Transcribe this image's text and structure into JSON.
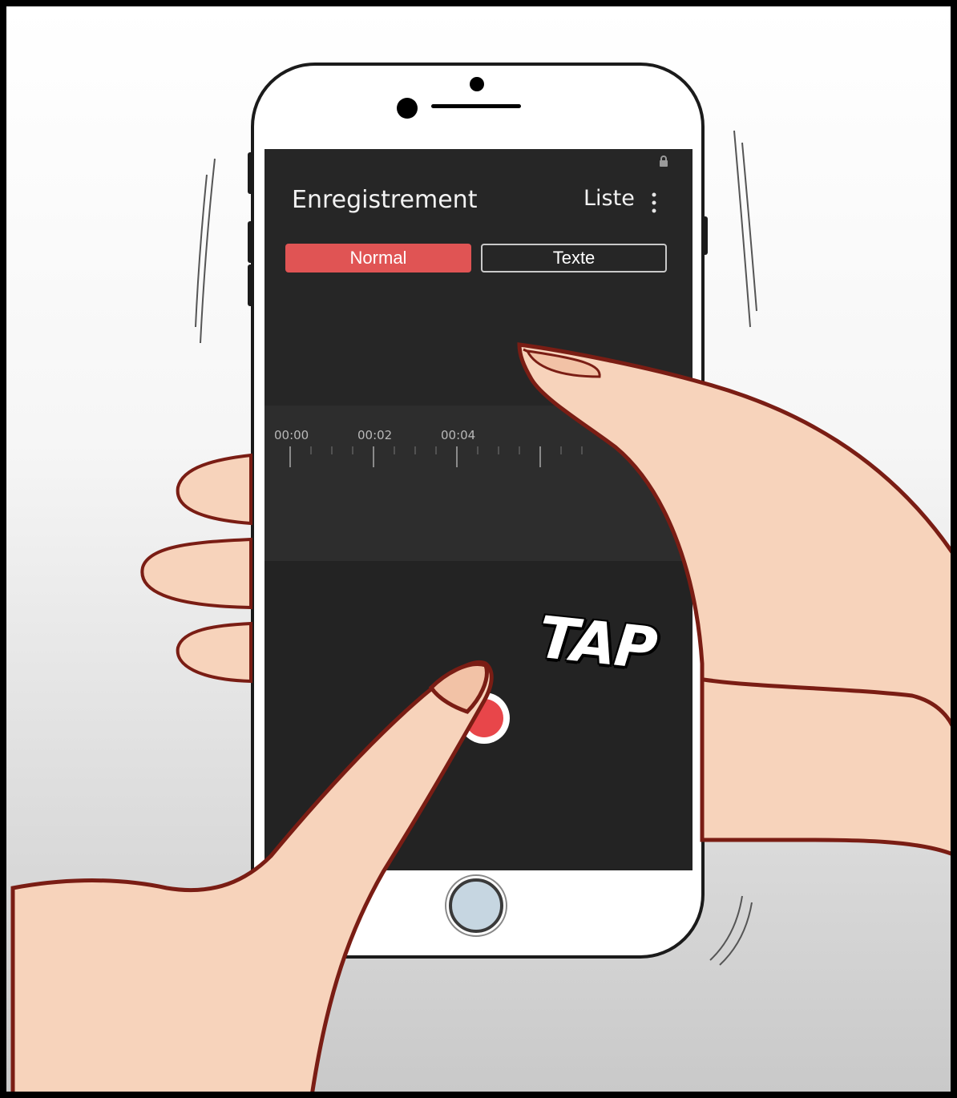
{
  "app": {
    "title": "Enregistrement",
    "list_label": "Liste",
    "menu_icon": "more-vertical-icon",
    "lock_icon": "lock-icon"
  },
  "modes": [
    {
      "label": "Normal",
      "selected": true
    },
    {
      "label": "Texte",
      "selected": false
    }
  ],
  "timeline": {
    "ticks": [
      "00:00",
      "00:02",
      "00:04"
    ]
  },
  "record_button": {
    "icon": "record-icon"
  },
  "comic": {
    "sfx": "TAP"
  },
  "colors": {
    "accent": "#e05454",
    "record": "#e8464a",
    "screen_bg": "#262626",
    "skin": "#f7d3bb",
    "outline": "#7a1d14"
  }
}
